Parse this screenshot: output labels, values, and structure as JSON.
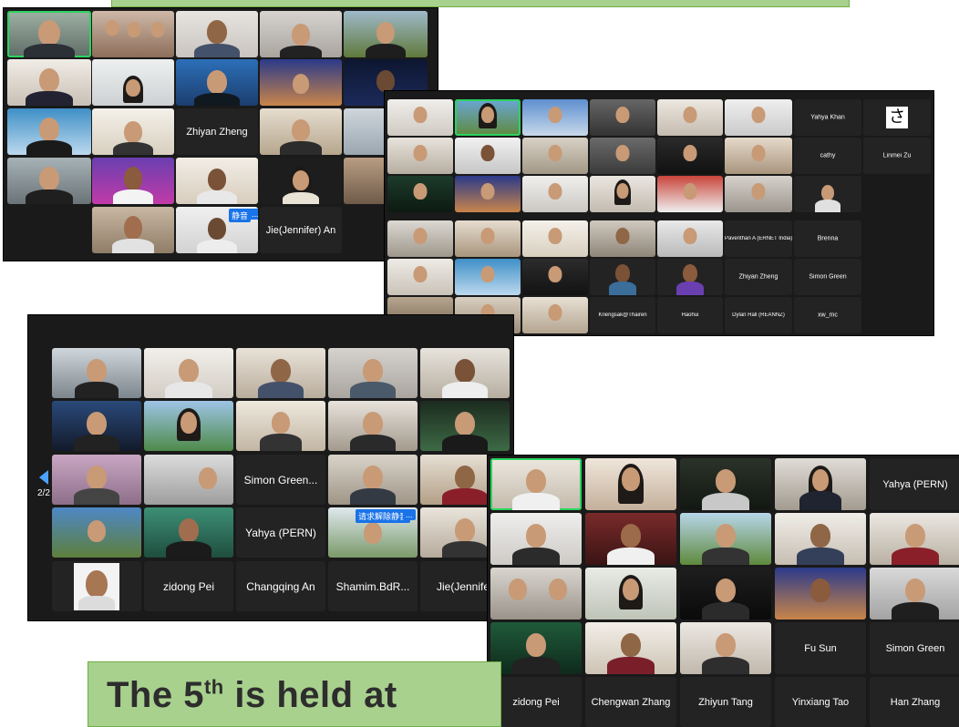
{
  "caption": {
    "prefix": "The 5",
    "superscript": "th",
    "suffix": " is held at"
  },
  "screenshot_1": {
    "names": {
      "zhiyan": "Zhiyan Zheng",
      "jie": "Jie(Jennifer) An"
    },
    "badge": "静音",
    "badge_more": "..."
  },
  "screenshot_2": {
    "names": {
      "yahya": "Yahya Khan",
      "sa": "さ",
      "cathy": "cathy",
      "linmei": "Linmei Zu",
      "paventhan": "Paventhan A (ERNET India)",
      "brenna": "Brenna",
      "zhiyan": "Zhiyan Zheng",
      "simon": "Simon Green",
      "kriengsak": "Kriengsak@Thairen",
      "haohui": "Haohui",
      "dylan": "Dylan Hall (REANNZ)",
      "xw": "xw_mc"
    }
  },
  "screenshot_3": {
    "pager": "2/2",
    "names": {
      "simon": "Simon Green...",
      "yahya": "Yahya (PERN)",
      "zidong": "zidong Pei",
      "changqing": "Changqing An",
      "shamim": "Shamim.BdR...",
      "jie": "Jie(Jennifer"
    },
    "badge": "请求解除静音",
    "badge_more": "..."
  },
  "screenshot_4": {
    "names": {
      "yahya": "Yahya (PERN)",
      "fu": "Fu Sun",
      "simon": "Simon Green",
      "zidong": "zidong Pei",
      "chengwan": "Chengwan Zhang",
      "zhiyun": "Zhiyun Tang",
      "yinxiang": "Yinxiang Tao",
      "han": "Han Zhang"
    }
  }
}
